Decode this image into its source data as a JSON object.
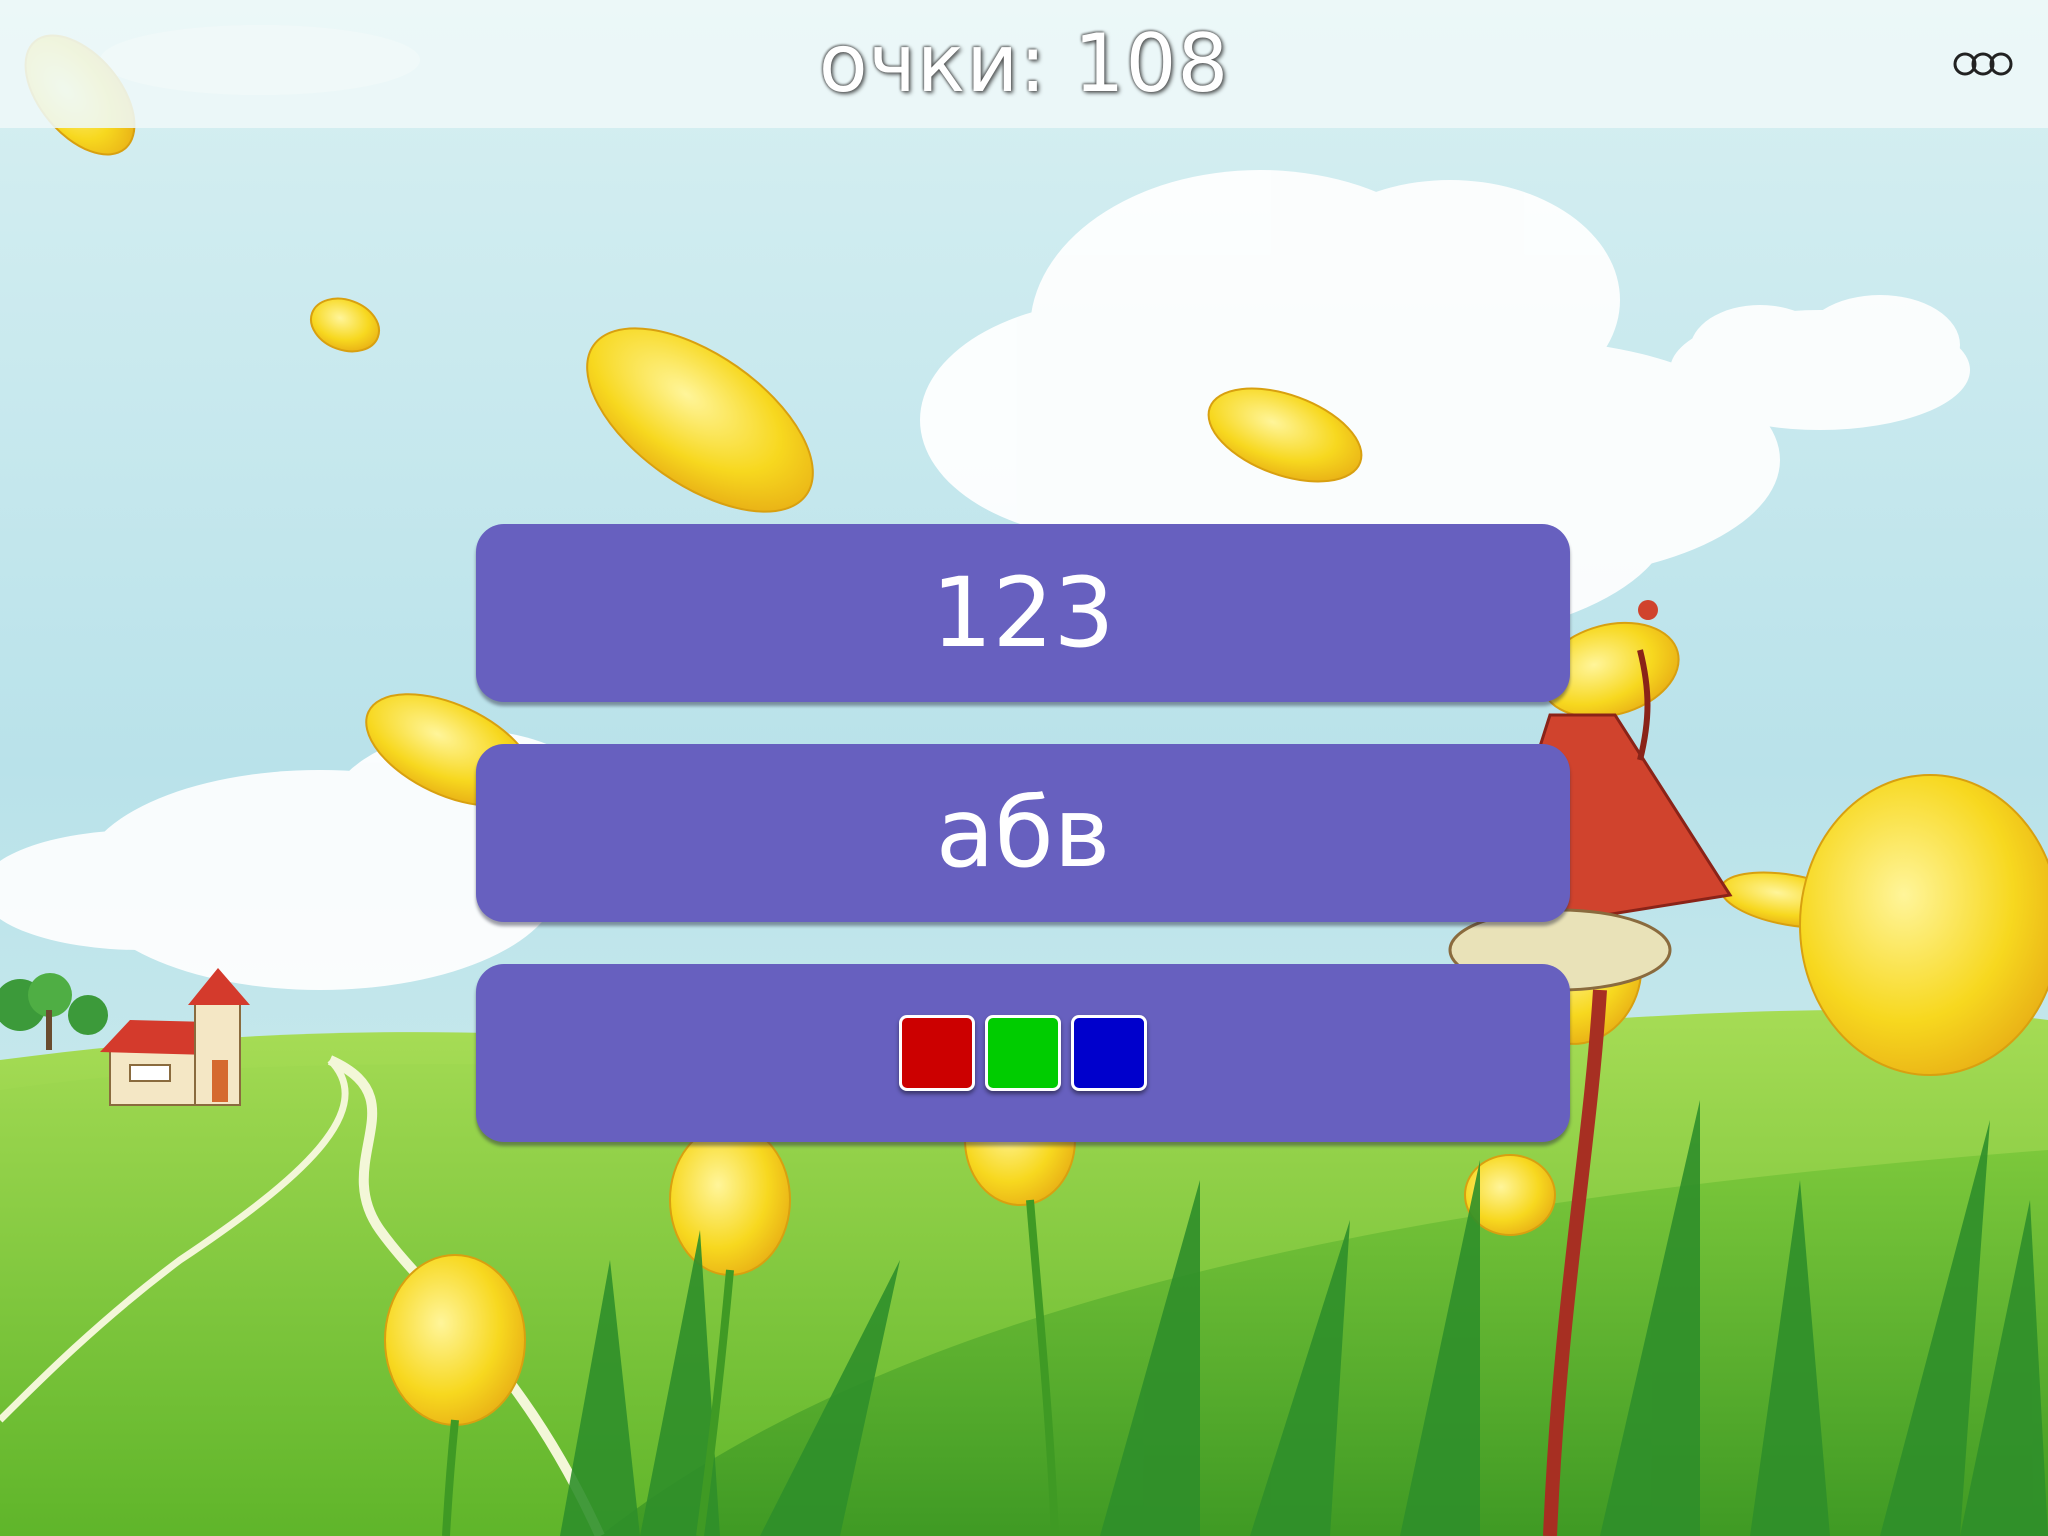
{
  "hud": {
    "score_text": "очки: 108",
    "menu_icon": "three-rings-menu-icon"
  },
  "choices": [
    {
      "label": "123"
    },
    {
      "label": "абв"
    },
    {
      "label": "",
      "swatch_colors": [
        "#cc0000",
        "#00cc00",
        "#0000cc"
      ]
    }
  ],
  "colors": {
    "button_fill": "#6760bf",
    "score_text": "#ffffff"
  }
}
